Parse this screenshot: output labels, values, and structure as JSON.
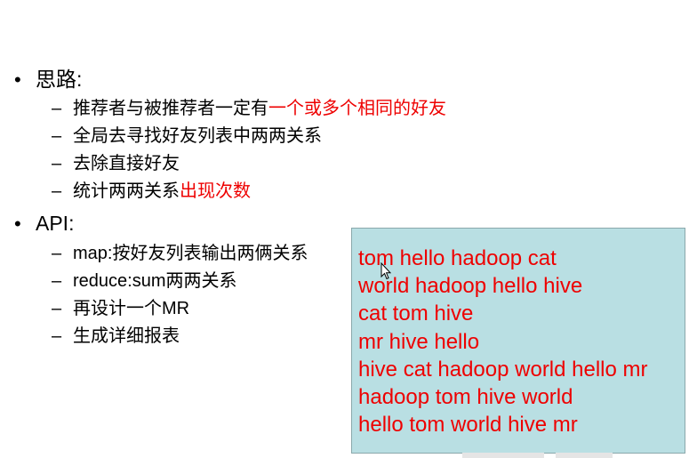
{
  "slide": {
    "section1": {
      "bullet": "•",
      "heading": "思路:",
      "items": [
        {
          "dash": "–",
          "text": "推荐者与被推荐者一定有",
          "highlight": "一个或多个相同的好友"
        },
        {
          "dash": "–",
          "text": "全局去寻找好友列表中两两关系",
          "highlight": ""
        },
        {
          "dash": "–",
          "text": "去除直接好友",
          "highlight": ""
        },
        {
          "dash": "–",
          "text": "统计两两关系",
          "highlight": "出现次数"
        }
      ]
    },
    "section2": {
      "bullet": "•",
      "heading": "API:",
      "items": [
        {
          "dash": "–",
          "text": "map:按好友列表输出两俩关系"
        },
        {
          "dash": "–",
          "text": "reduce:sum两两关系"
        },
        {
          "dash": "–",
          "text": "再设计一个MR"
        },
        {
          "dash": "–",
          "text": "生成详细报表"
        }
      ]
    }
  },
  "popup": {
    "lines": [
      "tom hello hadoop cat",
      "world hadoop hello hive",
      "cat tom hive",
      "mr hive hello",
      "hive cat hadoop world hello mr",
      "hadoop tom hive world",
      "hello tom world hive mr"
    ]
  },
  "colors": {
    "highlight": "#ee0000",
    "popup_background": "#b9dfe3",
    "popup_border": "#8aa8ab",
    "text": "#000000"
  },
  "icons": {
    "cursor": "mouse-pointer-icon"
  }
}
